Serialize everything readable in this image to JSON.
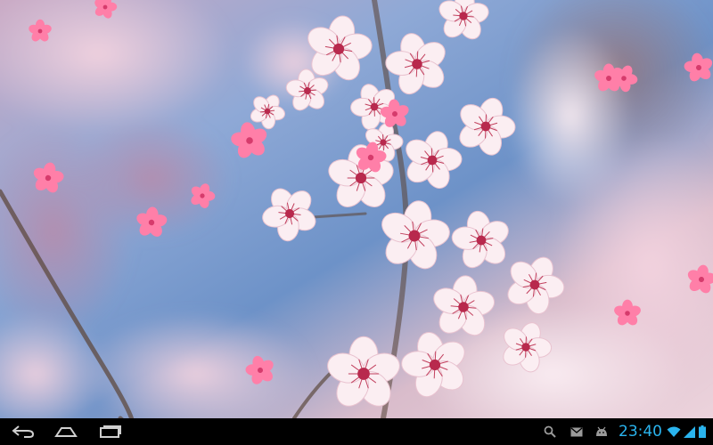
{
  "wallpaper": {
    "subject": "cherry-blossom-live-wallpaper",
    "colors": {
      "sky": "#7fa3cf",
      "blossom": "#f2c9d5",
      "petal": "#ff7fa8",
      "bokeh": "#e6b8c9"
    }
  },
  "navigation_bar": {
    "back_icon": "back-arrow-icon",
    "home_icon": "home-icon",
    "recent_apps_icon": "recent-apps-icon"
  },
  "status_bar": {
    "time": "23:40",
    "accent": "#2ab4ee",
    "icons": [
      "search-icon",
      "gmail-icon",
      "android-notification-icon",
      "wifi-icon",
      "signal-icon",
      "battery-icon"
    ]
  }
}
